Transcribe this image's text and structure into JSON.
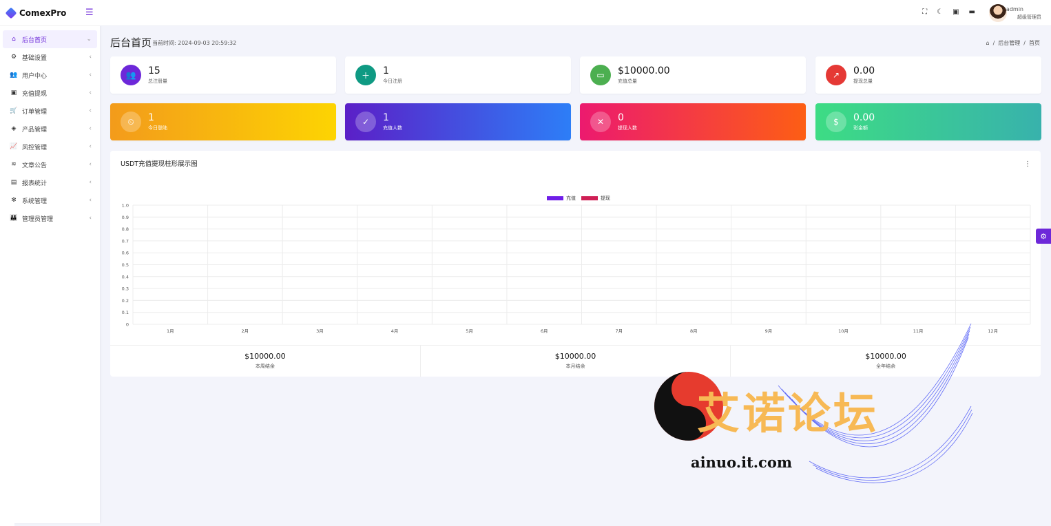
{
  "app": {
    "name": "ComexPro",
    "menu_toggle": "☰"
  },
  "sidebar": {
    "items": [
      {
        "label": "后台首页",
        "icon": "home-icon",
        "glyph": "⌂",
        "active": true,
        "caret": "⌄"
      },
      {
        "label": "基础设置",
        "icon": "cogs-icon",
        "glyph": "⚙",
        "active": false,
        "caret": "‹"
      },
      {
        "label": "用户中心",
        "icon": "users-icon",
        "glyph": "👥",
        "active": false,
        "caret": "‹"
      },
      {
        "label": "充值提现",
        "icon": "money-icon",
        "glyph": "▣",
        "active": false,
        "caret": "‹"
      },
      {
        "label": "订单管理",
        "icon": "cart-icon",
        "glyph": "🛒",
        "active": false,
        "caret": "‹"
      },
      {
        "label": "产品管理",
        "icon": "cubes-icon",
        "glyph": "◈",
        "active": false,
        "caret": "‹"
      },
      {
        "label": "风控管理",
        "icon": "chart-line-icon",
        "glyph": "📈",
        "active": false,
        "caret": "‹"
      },
      {
        "label": "文章公告",
        "icon": "layers-icon",
        "glyph": "≋",
        "active": false,
        "caret": "‹"
      },
      {
        "label": "报表统计",
        "icon": "coins-icon",
        "glyph": "▤",
        "active": false,
        "caret": "‹"
      },
      {
        "label": "系统管理",
        "icon": "gear-icon",
        "glyph": "✻",
        "active": false,
        "caret": "‹"
      },
      {
        "label": "管理员管理",
        "icon": "user-group-icon",
        "glyph": "👪",
        "active": false,
        "caret": "‹"
      }
    ]
  },
  "topbar": {
    "icons": [
      "fullscreen-icon",
      "moon-icon",
      "money-icon",
      "message-icon"
    ],
    "glyphs": [
      "⛶",
      "☾",
      "▣",
      "▬"
    ],
    "user_name": "admin",
    "user_role": "超级管理员"
  },
  "header": {
    "title": "后台首页",
    "time_label": "当前时间: 2024-09-03 20:59:32",
    "breadcrumb": [
      "后台管理",
      "首页"
    ],
    "breadcrumb_sep": "/",
    "home_glyph": "⌂"
  },
  "stats": [
    {
      "value": "15",
      "label": "总注册量",
      "icon": "users-icon",
      "glyph": "👥",
      "color": "#6d28d9"
    },
    {
      "value": "1",
      "label": "今日注册",
      "icon": "user-plus-icon",
      "glyph": "＋",
      "color": "#0f9a83"
    },
    {
      "value": "$10000.00",
      "label": "充值总量",
      "icon": "wallet-icon",
      "glyph": "▭",
      "color": "#4caf50"
    },
    {
      "value": "0.00",
      "label": "提现总量",
      "icon": "external-link-icon",
      "glyph": "↗",
      "color": "#e53935"
    },
    {
      "value": "1",
      "label": "今日登陆",
      "icon": "user-clock-icon",
      "glyph": "⏲",
      "gradient": "linear-gradient(90deg,#f39b1b,#fdd402)"
    },
    {
      "value": "1",
      "label": "充值人数",
      "icon": "user-check-icon",
      "glyph": "✓",
      "gradient": "linear-gradient(90deg,#5b1fc7,#2d7ef7)"
    },
    {
      "value": "0",
      "label": "提现人数",
      "icon": "user-times-icon",
      "glyph": "✕",
      "gradient": "linear-gradient(90deg,#ec1a6f,#fd5e14)"
    },
    {
      "value": "0.00",
      "label": "彩金额",
      "icon": "money-bill-icon",
      "glyph": "$",
      "gradient": "linear-gradient(90deg,#3ddc84,#38b2ac)"
    }
  ],
  "chart": {
    "title": "USDT充值提现柱形展示图",
    "menu_glyph": "⋮"
  },
  "chart_data": {
    "type": "bar",
    "categories": [
      "1月",
      "2月",
      "3月",
      "4月",
      "5月",
      "6月",
      "7月",
      "8月",
      "9月",
      "10月",
      "11月",
      "12月"
    ],
    "series": [
      {
        "name": "充值",
        "color": "#6f1ee8",
        "values": [
          0,
          0,
          0,
          0,
          0,
          0,
          0,
          0,
          0,
          0,
          0,
          0
        ]
      },
      {
        "name": "提现",
        "color": "#cf1f55",
        "values": [
          0,
          0,
          0,
          0,
          0,
          0,
          0,
          0,
          0,
          0,
          0,
          0
        ]
      }
    ],
    "yticks": [
      "1.0",
      "0.9",
      "0.8",
      "0.7",
      "0.6",
      "0.5",
      "0.4",
      "0.3",
      "0.2",
      "0.1",
      "0"
    ],
    "ylim": [
      0,
      1
    ],
    "grid": true,
    "legend": "top-center"
  },
  "summary": [
    {
      "value": "$10000.00",
      "label": "本周结余"
    },
    {
      "value": "$10000.00",
      "label": "本月结余"
    },
    {
      "value": "$10000.00",
      "label": "全年结余"
    }
  ],
  "watermark": {
    "text": "艾诺论坛",
    "url": "ainuo.it.com"
  },
  "settings_glyph": "⚙"
}
